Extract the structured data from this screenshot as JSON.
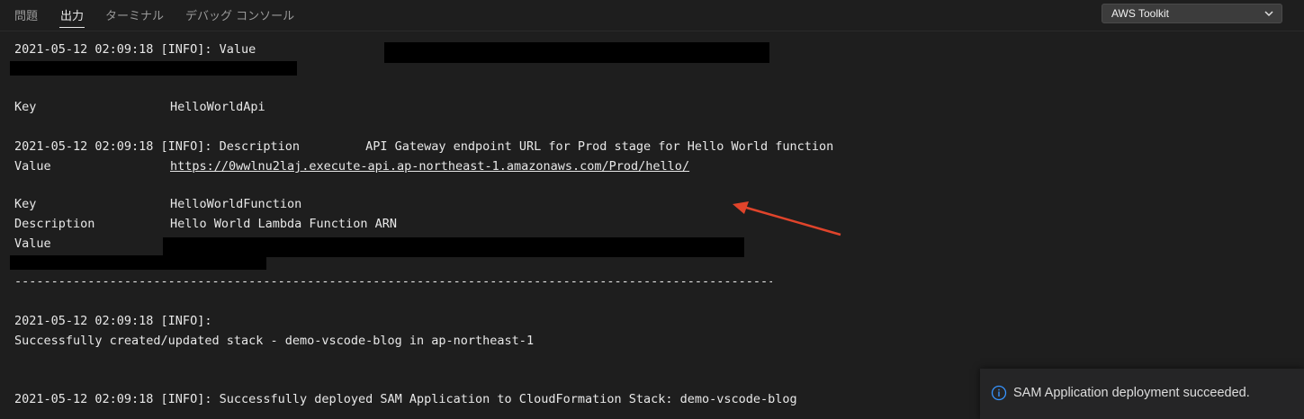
{
  "panel": {
    "tabs": [
      {
        "label": "問題"
      },
      {
        "label": "出力"
      },
      {
        "label": "ターミナル"
      },
      {
        "label": "デバッグ コンソール"
      }
    ],
    "active_tab": "出力",
    "output_channel": "AWS Toolkit"
  },
  "output": {
    "line1": "2021-05-12 02:09:18 [INFO]: Value",
    "line2_key": "Key",
    "line2_val": "HelloWorldApi",
    "line3_prefix": "2021-05-12 02:09:18 [INFO]: Description",
    "line3_val": "API Gateway endpoint URL for Prod stage for Hello World function",
    "line4_key": "Value",
    "line4_url": "https://0wwlnu2laj.execute-api.ap-northeast-1.amazonaws.com/Prod/hello/",
    "line5_key": "Key",
    "line5_val": "HelloWorldFunction",
    "line6_key": "Description",
    "line6_val": "Hello World Lambda Function ARN",
    "line7_key": "Value",
    "separator": "-------------------------------------------------------------------------------------------------------------",
    "line8": "2021-05-12 02:09:18 [INFO]:",
    "line9": "Successfully created/updated stack - demo-vscode-blog in ap-northeast-1",
    "line10": "2021-05-12 02:09:18 [INFO]: Successfully deployed SAM Application to CloudFormation Stack: demo-vscode-blog"
  },
  "annotation": {
    "color": "#e0442b"
  },
  "notification": {
    "icon": "info-icon",
    "message": "SAM Application deployment succeeded.",
    "accent": "#3794ff"
  },
  "colors": {
    "background": "#1e1e1e",
    "text": "#e8e8e8"
  }
}
